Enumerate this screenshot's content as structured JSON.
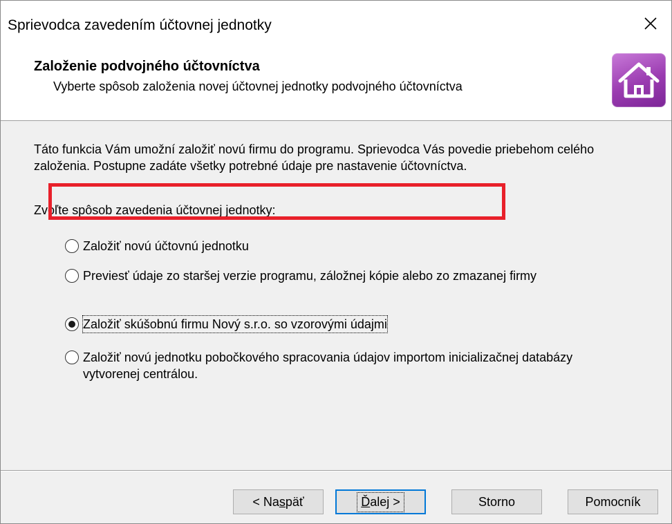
{
  "window": {
    "title": "Sprievodca zavedením účtovnej jednotky"
  },
  "header": {
    "title": "Založenie podvojného účtovníctva",
    "subtitle": "Vyberte spôsob založenia novej účtovnej jednotky podvojného účtovníctva",
    "logo_icon": "house-icon"
  },
  "content": {
    "intro": "Táto funkcia Vám umožní založiť novú firmu do programu. Sprievodca Vás povedie priebehom celého založenia. Postupne zadáte všetky potrebné údaje pre nastavenie účtovníctva.",
    "prompt": "Zvoľte spôsob zavedenia účtovnej jednotky:",
    "options": [
      {
        "label": "Založiť novú účtovnú jednotku",
        "selected": false
      },
      {
        "label": "Previesť údaje zo staršej verzie programu, záložnej kópie alebo zo zmazanej firmy",
        "selected": false
      },
      {
        "label": "Založiť skúšobnú firmu Nový s.r.o. so vzorovými údajmi",
        "selected": true
      },
      {
        "label": "Založiť novú jednotku pobočkového spracovania údajov importom inicializačnej databázy vytvorenej centrálou.",
        "selected": false
      }
    ]
  },
  "footer": {
    "back": {
      "pre": "< Na",
      "u": "s",
      "post": "päť"
    },
    "next": {
      "pre": "",
      "u": "Ď",
      "post": "alej >"
    },
    "cancel": "Storno",
    "help": "Pomocník"
  },
  "colors": {
    "highlight": "#e8202a",
    "accent": "#0078d7",
    "logo": "#9a3bb0"
  }
}
